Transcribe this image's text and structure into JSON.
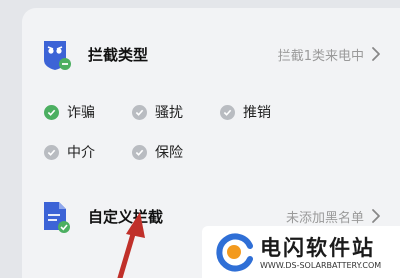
{
  "row_block": {
    "title": "拦截类型",
    "value": "拦截1类来电中",
    "icon": "shield-block-icon"
  },
  "types": [
    {
      "label": "诈骗",
      "checked": true
    },
    {
      "label": "骚扰",
      "checked": false
    },
    {
      "label": "推销",
      "checked": false
    },
    {
      "label": "中介",
      "checked": false
    },
    {
      "label": "保险",
      "checked": false
    }
  ],
  "row_custom": {
    "title": "自定义拦截",
    "value": "未添加黑名单",
    "icon": "document-check-icon"
  },
  "watermark": {
    "name": "电闪软件站",
    "url": "WWW.DS-SOLARBATTERY.COM"
  },
  "colors": {
    "primary_blue": "#3c63d6",
    "check_green": "#4caf61",
    "arrow": "#c0302a"
  }
}
